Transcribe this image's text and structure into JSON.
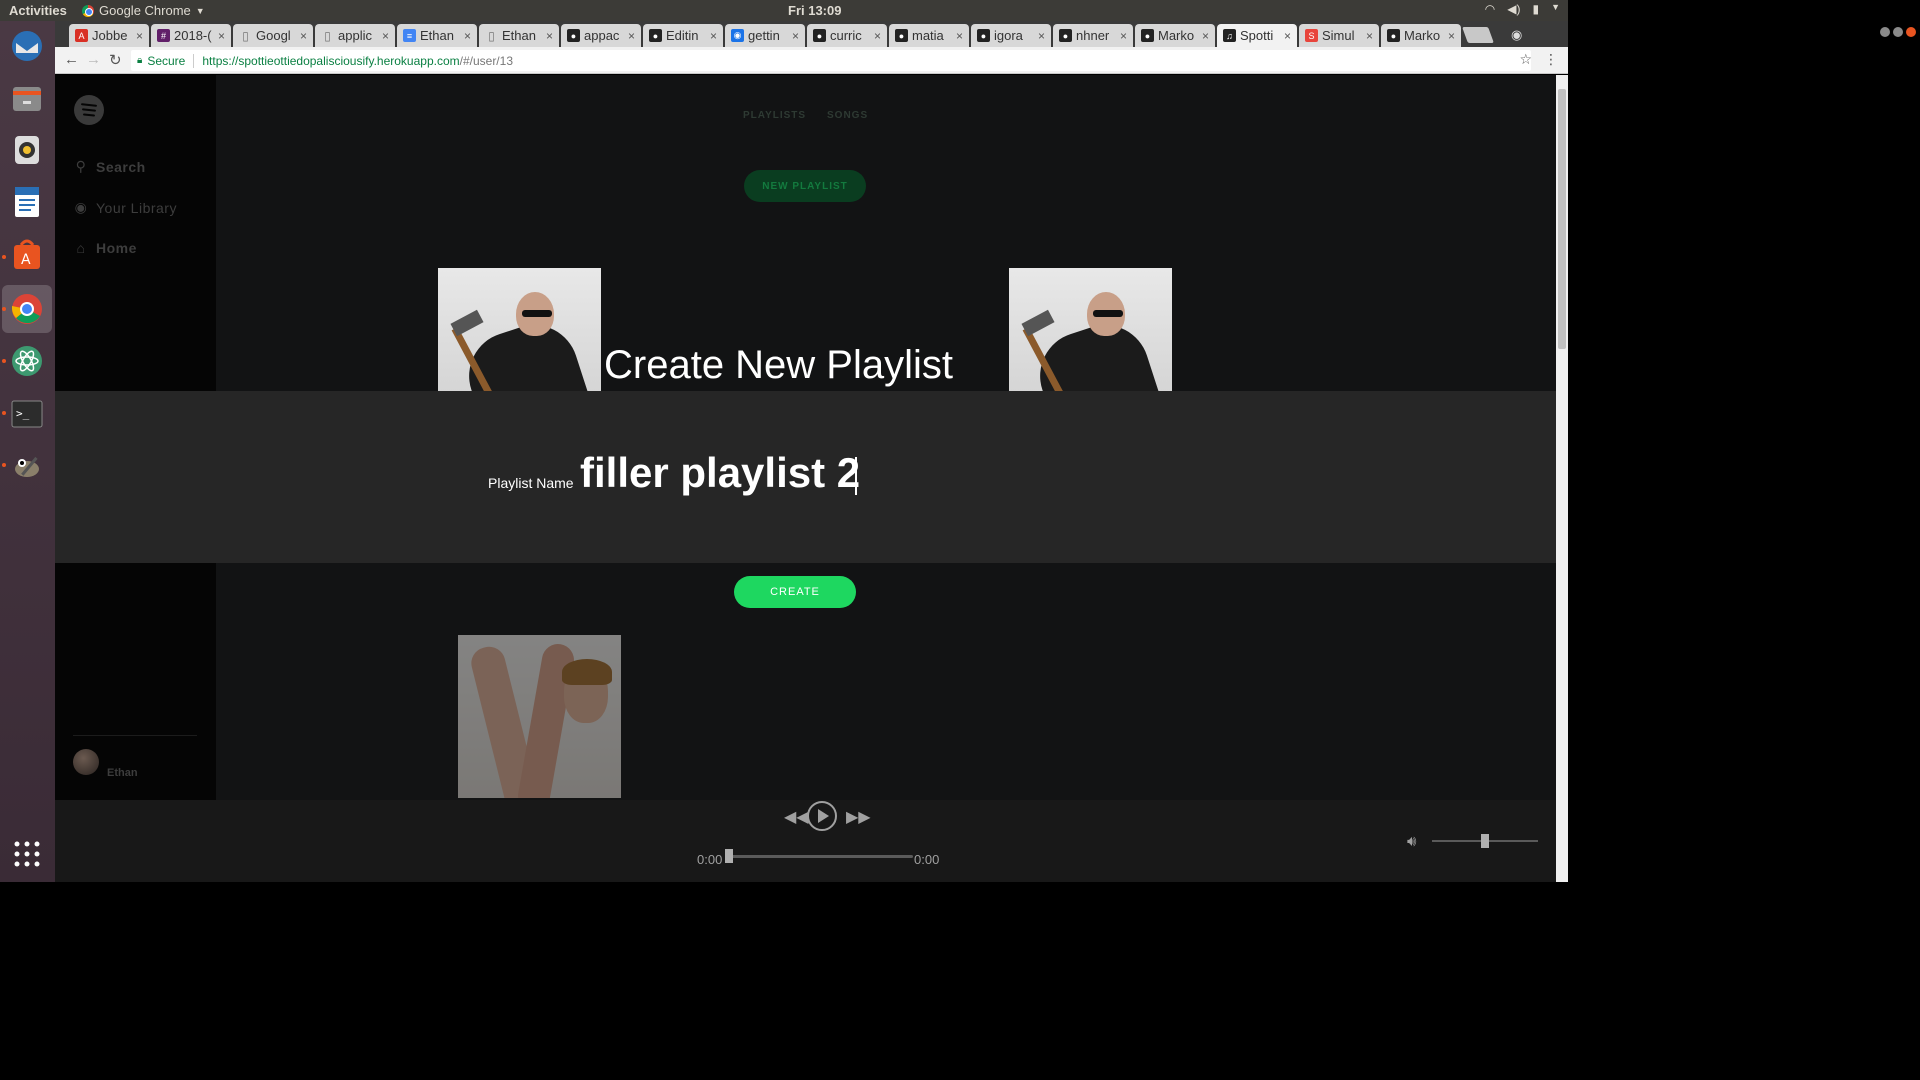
{
  "os": {
    "activities": "Activities",
    "app_name": "Google Chrome",
    "clock": "Fri 13:09"
  },
  "tabs": [
    {
      "title": "Jobbe",
      "icon": "angellist-icon",
      "color": "#d93025"
    },
    {
      "title": "2018-(",
      "icon": "slack-icon",
      "color": "#611f69"
    },
    {
      "title": "Googl",
      "icon": "document-icon",
      "color": "#777777"
    },
    {
      "title": "applic",
      "icon": "document-icon",
      "color": "#777777"
    },
    {
      "title": "Ethan",
      "icon": "google-docs-icon",
      "color": "#4285f4"
    },
    {
      "title": "Ethan",
      "icon": "document-icon",
      "color": "#777777"
    },
    {
      "title": "appac",
      "icon": "github-icon",
      "color": "#222222"
    },
    {
      "title": "Editin",
      "icon": "github-icon",
      "color": "#222222"
    },
    {
      "title": "gettin",
      "icon": "circle-icon",
      "color": "#1a73e8"
    },
    {
      "title": "curric",
      "icon": "github-icon",
      "color": "#222222"
    },
    {
      "title": "matia",
      "icon": "github-icon",
      "color": "#222222"
    },
    {
      "title": "igora",
      "icon": "github-icon",
      "color": "#222222"
    },
    {
      "title": "nhner",
      "icon": "github-icon",
      "color": "#222222"
    },
    {
      "title": "Marko",
      "icon": "github-icon",
      "color": "#222222"
    },
    {
      "title": "Spotti",
      "icon": "spotify-icon",
      "color": "#222222",
      "active": true
    },
    {
      "title": "Simul",
      "icon": "slides-icon",
      "color": "#e8453c"
    },
    {
      "title": "Marko",
      "icon": "github-icon",
      "color": "#222222"
    }
  ],
  "omnibox": {
    "secure_label": "Secure",
    "url_main": "https://spottieottiedopalisciousify.herokuapp.com",
    "url_rest": "/#/user/13"
  },
  "sidebar": {
    "items": [
      {
        "label": "Search",
        "icon": "search-icon"
      },
      {
        "label": "Your Library",
        "icon": "library-icon"
      },
      {
        "label": "Home",
        "icon": "home-icon"
      }
    ],
    "user_name": "Ethan"
  },
  "main": {
    "nav": [
      "PLAYLISTS",
      "SONGS"
    ],
    "new_playlist_label": "NEW PLAYLIST"
  },
  "modal": {
    "title": "Create New Playlist",
    "name_label": "Playlist Name",
    "name_value": "filler playlist 2",
    "create_label": "CREATE"
  },
  "player": {
    "elapsed": "0:00",
    "duration": "0:00",
    "progress": 0,
    "volume": 0.5
  },
  "colors": {
    "accent": "#1ed760",
    "background": "#121314",
    "modal": "#262626"
  }
}
